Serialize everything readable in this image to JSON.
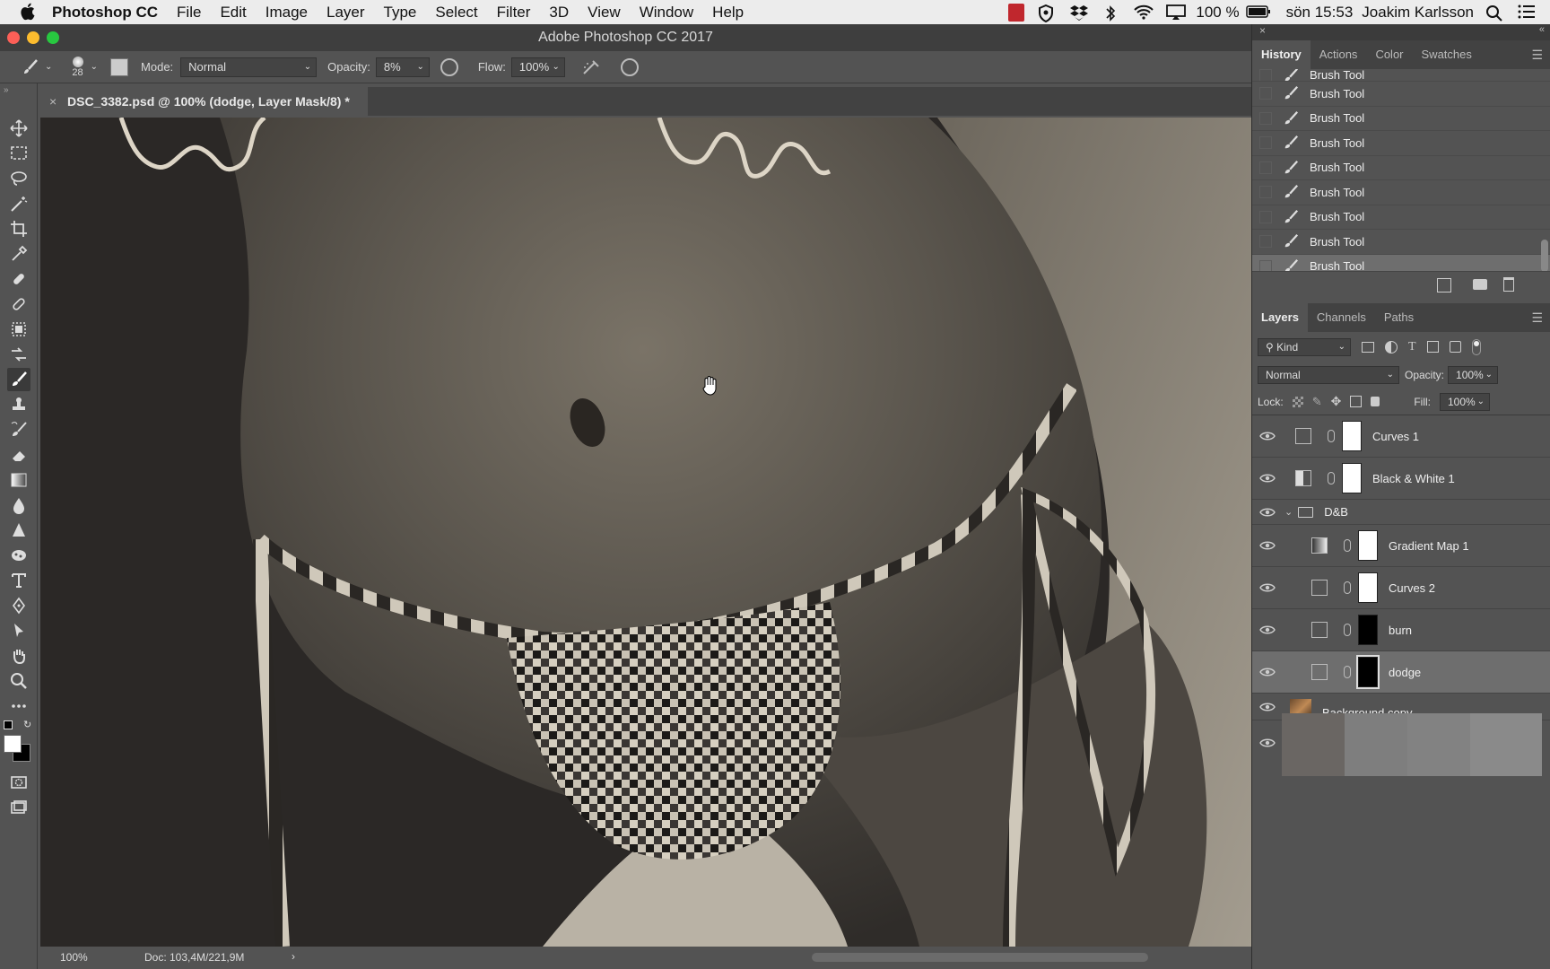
{
  "menubar": {
    "app": "Photoshop CC",
    "items": [
      "File",
      "Edit",
      "Image",
      "Layer",
      "Type",
      "Select",
      "Filter",
      "3D",
      "View",
      "Window",
      "Help"
    ],
    "battery": "100 %",
    "clock": "sön 15:53",
    "user": "Joakim Karlsson"
  },
  "window": {
    "title": "Adobe Photoshop CC 2017"
  },
  "options": {
    "brush_size": "28",
    "mode_label": "Mode:",
    "mode_value": "Normal",
    "opacity_label": "Opacity:",
    "opacity_value": "8%",
    "flow_label": "Flow:",
    "flow_value": "100%"
  },
  "document": {
    "tab_title": "DSC_3382.psd @ 100% (dodge, Layer Mask/8) *"
  },
  "status": {
    "zoom": "100%",
    "doc": "Doc: 103,4M/221,9M"
  },
  "history_panel": {
    "tabs": [
      "History",
      "Actions",
      "Color",
      "Swatches"
    ],
    "items": [
      "Brush Tool",
      "Brush Tool",
      "Brush Tool",
      "Brush Tool",
      "Brush Tool",
      "Brush Tool",
      "Brush Tool",
      "Brush Tool",
      "Brush Tool"
    ]
  },
  "layers_panel": {
    "tabs": [
      "Layers",
      "Channels",
      "Paths"
    ],
    "filter": "Kind",
    "blend": "Normal",
    "opacity_label": "Opacity:",
    "opacity_value": "100%",
    "lock_label": "Lock:",
    "fill_label": "Fill:",
    "fill_value": "100%",
    "layers": [
      {
        "name": "Curves 1"
      },
      {
        "name": "Black & White 1"
      },
      {
        "name": "D&B"
      },
      {
        "name": "Gradient Map 1"
      },
      {
        "name": "Curves 2"
      },
      {
        "name": "burn"
      },
      {
        "name": "dodge"
      },
      {
        "name": "Background copy"
      }
    ]
  },
  "colors": {
    "accent": "#6e6e6e",
    "panel_bg": "#535353",
    "dark_bg": "#424242"
  }
}
